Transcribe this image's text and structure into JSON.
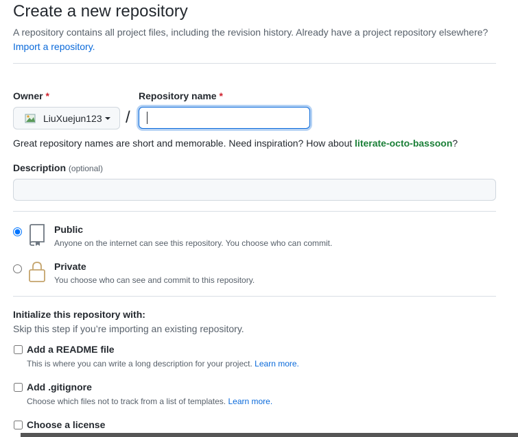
{
  "header": {
    "title": "Create a new repository",
    "subtitle": "A repository contains all project files, including the revision history. Already have a project repository elsewhere?",
    "import_link": "Import a repository."
  },
  "owner": {
    "label": "Owner",
    "required_mark": "*",
    "value": "LiuXuejun123"
  },
  "repo_name": {
    "label": "Repository name",
    "required_mark": "*",
    "value": "",
    "separator": "/"
  },
  "name_hint": {
    "text": "Great repository names are short and memorable. Need inspiration? How about ",
    "suggestion": "literate-octo-bassoon",
    "suffix": "?"
  },
  "description": {
    "label": "Description",
    "optional": "(optional)",
    "value": ""
  },
  "visibility": {
    "public": {
      "title": "Public",
      "note": "Anyone on the internet can see this repository. You choose who can commit.",
      "selected": true
    },
    "private": {
      "title": "Private",
      "note": "You choose who can see and commit to this repository.",
      "selected": false
    }
  },
  "initialize": {
    "title": "Initialize this repository with:",
    "subtitle": "Skip this step if you’re importing an existing repository.",
    "readme": {
      "label": "Add a README file",
      "note": "This is where you can write a long description for your project.",
      "link": "Learn more."
    },
    "gitignore": {
      "label": "Add .gitignore",
      "note": "Choose which files not to track from a list of templates.",
      "link": "Learn more."
    },
    "license": {
      "label": "Choose a license"
    }
  },
  "icons": {
    "public": "repo-icon",
    "private": "lock-icon",
    "owner_avatar": "avatar-icon"
  },
  "colors": {
    "link": "#0969da",
    "suggestion": "#1a7f37",
    "required": "#cf222e",
    "focus": "#0969da"
  }
}
